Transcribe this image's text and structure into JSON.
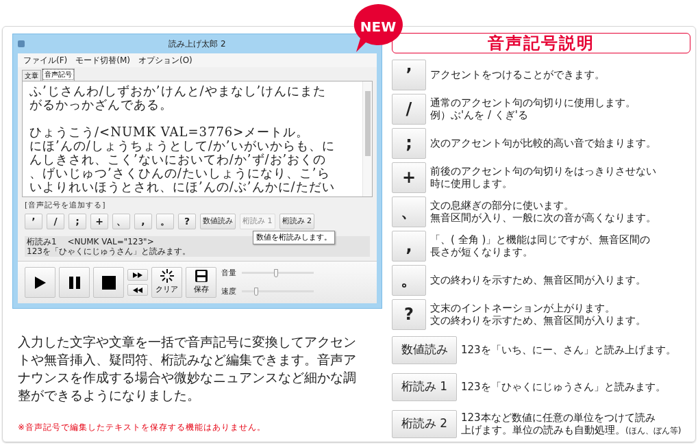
{
  "badge": "NEW",
  "window": {
    "title": "読み上げ太郎 2",
    "menu": [
      "ファイル(F)",
      "モード切替(M)",
      "オプション(O)"
    ],
    "tabs": [
      {
        "label": "文章",
        "selected": false
      },
      {
        "label": "音声記号",
        "selected": true
      }
    ],
    "editor_paragraphs": [
      [
        "ふ’じさんわ/しずおか’けんと/やまなし’けんにまた",
        "がるかっかざんである。"
      ],
      [
        "ひょうこう/<NUMK VAL=3776>メートル。",
        "にほ’んの/しょうちょうとして/か’いがいからも、に",
        "んしきされ、こく’ないにおいてわ/か’ず/お’おくの",
        "、げいじゅつ’さくひんの/たいしょうになり、こ’ら",
        "いよりれいほうとされ、にほ’んの/ぶ’んかに/ただい"
      ]
    ],
    "symbol_heading": "[音声記号を追加する]",
    "symbol_buttons": [
      {
        "label": "’",
        "kind": "symbol",
        "hovered": false
      },
      {
        "label": "/",
        "kind": "symbol",
        "hovered": false
      },
      {
        "label": ";",
        "kind": "symbol",
        "hovered": false
      },
      {
        "label": "+",
        "kind": "symbol",
        "hovered": false
      },
      {
        "label": "、",
        "kind": "symbol",
        "hovered": false
      },
      {
        "label": ",",
        "kind": "symbol",
        "hovered": false
      },
      {
        "label": "。",
        "kind": "symbol",
        "hovered": false
      },
      {
        "label": "?",
        "kind": "symbol",
        "hovered": false
      },
      {
        "label": "数値読み",
        "kind": "word",
        "hovered": false
      },
      {
        "label": "桁読み 1",
        "kind": "word",
        "hovered": true
      },
      {
        "label": "桁読み 2",
        "kind": "word",
        "hovered": false
      }
    ],
    "tooltip": "数値を桁読みします。",
    "info_lines": [
      "桁読み1　 <NUMK VAL=\"123\">",
      "123を「ひゃくにじゅうさん」と読みます。"
    ],
    "transport": [
      {
        "kind": "play"
      },
      {
        "kind": "pause"
      },
      {
        "kind": "stop"
      }
    ],
    "seek": [
      {
        "kind": "forward"
      },
      {
        "kind": "rewind"
      }
    ],
    "actions": [
      {
        "kind": "clear",
        "label": "クリア"
      },
      {
        "kind": "save",
        "label": "保存"
      }
    ],
    "sliders": [
      {
        "label": "音量",
        "level": 0.48
      },
      {
        "label": "速度",
        "level": 0.2
      }
    ]
  },
  "description": "入力した文字や文章を一括で音声記号に変換してアクセントや無音挿入、疑問符、桁読みなど編集できます。音声アナウンスを作成する場合や微妙なニュアンスなど細かな調整ができるようになりました。",
  "note": "※音声記号で編集したテキストを保存する機能はありません。",
  "legend": {
    "title": "音声記号説明",
    "items": [
      {
        "key": "’",
        "kind": "symbol",
        "lines": [
          "アクセントをつけることができます。"
        ]
      },
      {
        "key": "/",
        "kind": "symbol",
        "lines": [
          "通常のアクセント句の句切りに使用します。",
          "例）ぶ'んを / くぎ'る"
        ]
      },
      {
        "key": ";",
        "kind": "symbol",
        "lines": [
          "次のアクセント句が比較的高い音で始まります。"
        ]
      },
      {
        "key": "+",
        "kind": "symbol",
        "lines": [
          "前後のアクセント句の句切りをはっきりさせない",
          "時に使用します。"
        ]
      },
      {
        "key": "、",
        "kind": "symbol",
        "lines": [
          "文の息継ぎの部分に使います。",
          "無音区間が入り、一般に次の音が高くなります。"
        ]
      },
      {
        "key": ",",
        "kind": "symbol",
        "lines": [
          "「、( 全角 )」と機能は同じですが、無音区間の",
          "長さが短くなります。"
        ]
      },
      {
        "key": "。",
        "kind": "symbol",
        "lines": [
          "文の終わりを示すため、無音区間が入ります。"
        ]
      },
      {
        "key": "?",
        "kind": "symbol",
        "lines": [
          "文末のイントネーションが上がります。",
          "文の終わりを示すため、無音区間が入ります。"
        ]
      },
      {
        "key": "数値読み",
        "kind": "word",
        "lines": [
          "123を「いち、にー、さん」と読み上げます。"
        ]
      },
      {
        "key": "桁読み 1",
        "kind": "word",
        "lines": [
          "123を「ひゃくにじゅうさん」と読みます。"
        ]
      },
      {
        "key": "桁読み 2",
        "kind": "word",
        "lines": [
          "123本など数値に任意の単位をつけて読み",
          "上げます。単位の読みも自動処理。"
        ],
        "aside": "(ほん、ぼん等)"
      }
    ]
  }
}
